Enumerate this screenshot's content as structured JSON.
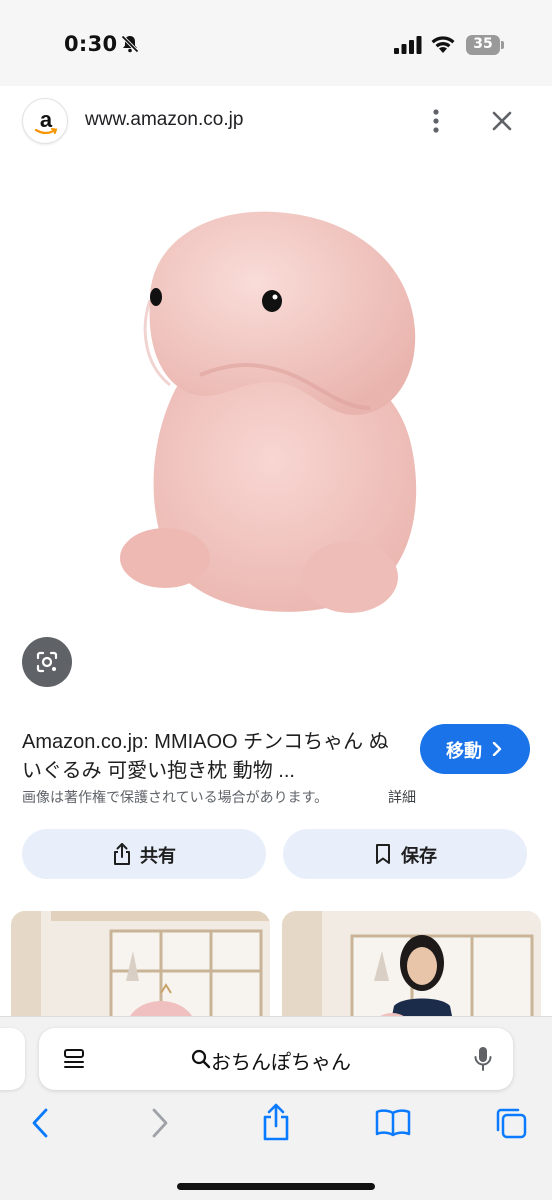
{
  "status_bar": {
    "time": "0:30",
    "battery": "35",
    "icons": [
      "bell-off-icon",
      "cellular-signal-icon",
      "wifi-icon",
      "battery-icon"
    ]
  },
  "header": {
    "site_letter": "a",
    "url": "www.amazon.co.jp",
    "icons": [
      "amazon-logo-icon",
      "more-vert-icon",
      "close-icon"
    ]
  },
  "product": {
    "lens_icon": "lens-search-icon",
    "title": "Amazon.co.jp: MMIAOO チンコちゃん ぬいぐるみ 可愛い抱き枕 動物 ...",
    "go_label": "移動",
    "copyright_note": "画像は著作権で保護されている場合があります。",
    "details_label": "詳細"
  },
  "actions": {
    "share_label": "共有",
    "save_label": "保存"
  },
  "browser": {
    "address_text": "おちんぽちゃん",
    "icons": [
      "reader-view-icon",
      "search-icon",
      "microphone-icon",
      "back-icon",
      "forward-icon",
      "share-icon",
      "bookmarks-icon",
      "tabs-icon"
    ]
  },
  "colors": {
    "accent": "#1a73e8",
    "action_button_bg": "#e8effb",
    "plush_pink": "#f3c9c6",
    "ios_blue": "#0a7aff"
  }
}
